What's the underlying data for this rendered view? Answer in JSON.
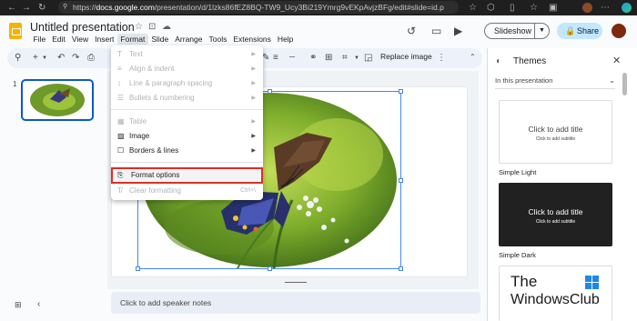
{
  "browser": {
    "url_prefix": "https://",
    "url_domain": "docs.google.com",
    "url_rest": "/presentation/d/1lzks86fEZ8BQ-TW9_Ucy3Bi219Ymrg9vEKpAvjzBFg/edit#slide=id.p"
  },
  "doc": {
    "title": "Untitled presentation"
  },
  "menubar": [
    "File",
    "Edit",
    "View",
    "Insert",
    "Format",
    "Slide",
    "Arrange",
    "Tools",
    "Extensions",
    "Help"
  ],
  "header": {
    "slideshow_label": "Slideshow",
    "share_label": "Share"
  },
  "toolbar": {
    "replace_image_label": "Replace image"
  },
  "filmstrip": {
    "slide_number": "1"
  },
  "format_menu": {
    "items": [
      {
        "label": "Text",
        "disabled": true,
        "submenu": true
      },
      {
        "label": "Align & indent",
        "disabled": true,
        "submenu": true
      },
      {
        "label": "Line & paragraph spacing",
        "disabled": true,
        "submenu": true
      },
      {
        "label": "Bullets & numbering",
        "disabled": true,
        "submenu": true
      },
      {
        "label": "Table",
        "disabled": true,
        "submenu": true
      },
      {
        "label": "Image",
        "disabled": false,
        "submenu": true
      },
      {
        "label": "Borders & lines",
        "disabled": false,
        "submenu": true
      },
      {
        "label": "Format options",
        "disabled": false,
        "submenu": false,
        "highlighted": true
      },
      {
        "label": "Clear formatting",
        "disabled": true,
        "submenu": false,
        "shortcut": "Ctrl+\\"
      }
    ]
  },
  "notes": {
    "placeholder": "Click to add speaker notes"
  },
  "themes": {
    "title": "Themes",
    "section": "In this presentation",
    "cards": [
      {
        "title": "Click to add title",
        "subtitle": "Click to add subtitle",
        "name": "Simple Light"
      },
      {
        "title": "Click to add title",
        "subtitle": "Click to add subtitle",
        "name": "Simple Dark"
      }
    ]
  },
  "watermark": {
    "line1": "The",
    "line2": "WindowsClub"
  },
  "colors": {
    "accent": "#0b57d0",
    "share_bg": "#c2e7ff",
    "highlight_border": "#d93025",
    "slides_logo": "#f4b400"
  }
}
